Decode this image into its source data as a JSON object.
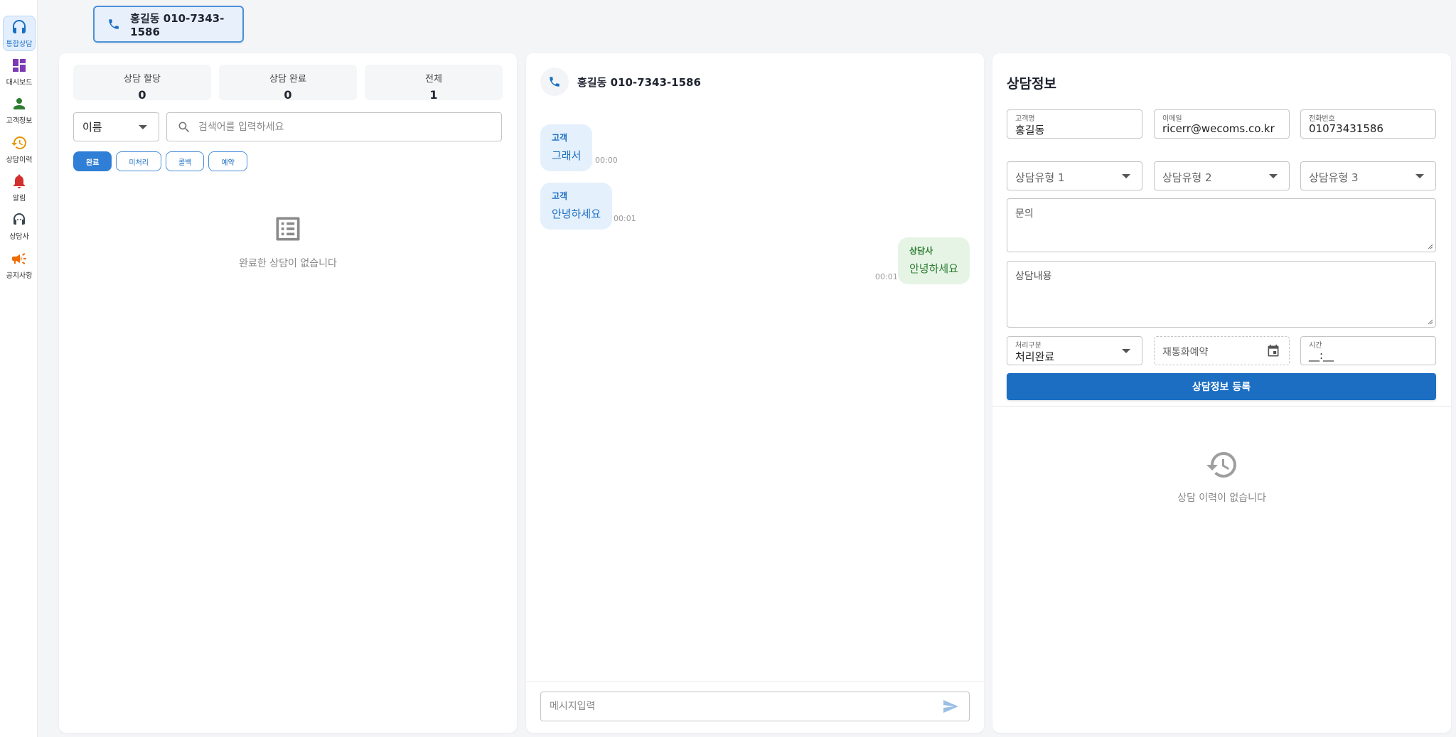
{
  "sidebar": {
    "items": [
      {
        "label": "통합상담",
        "icon": "headset-icon"
      },
      {
        "label": "대시보드",
        "icon": "dashboard-icon"
      },
      {
        "label": "고객정보",
        "icon": "person-icon"
      },
      {
        "label": "상담이력",
        "icon": "history-icon"
      },
      {
        "label": "알림",
        "icon": "bell-icon"
      },
      {
        "label": "상담사",
        "icon": "support-agent-icon"
      },
      {
        "label": "공지사항",
        "icon": "megaphone-icon"
      }
    ],
    "active_color": "#1b6ec2"
  },
  "topbar": {
    "call_tab_label": "홍길동 010-7343-1586"
  },
  "left": {
    "stats": [
      {
        "title": "상담 할당",
        "value": "0"
      },
      {
        "title": "상담 완료",
        "value": "0"
      },
      {
        "title": "전체",
        "value": "1"
      }
    ],
    "search_field": "이름",
    "search_placeholder": "검색어를 입력하세요",
    "filters": [
      "완료",
      "미처리",
      "콜백",
      "예약"
    ],
    "active_filter": "완료",
    "empty_text": "완료한 상담이 없습니다"
  },
  "chat": {
    "title": "홍길동 010-7343-1586",
    "messages": [
      {
        "sender": "고객",
        "text": "그래서",
        "time": "00:00",
        "direction": "in"
      },
      {
        "sender": "고객",
        "text": "안녕하세요",
        "time": "00:01",
        "direction": "in"
      },
      {
        "sender": "상담사",
        "text": "안녕하세요",
        "time": "00:01",
        "direction": "out"
      }
    ],
    "input_placeholder": "메시지입력"
  },
  "info": {
    "title": "상담정보",
    "customer_name": {
      "label": "고객명",
      "value": "홍길동"
    },
    "email": {
      "label": "이메일",
      "value": "ricerr@wecoms.co.kr"
    },
    "phone": {
      "label": "전화번호",
      "value": "01073431586"
    },
    "type1": "상담유형 1",
    "type2": "상담유형 2",
    "type3": "상담유형 3",
    "inquiry_placeholder": "문의",
    "content_placeholder": "상담내용",
    "process": {
      "label": "처리구분",
      "value": "처리완료"
    },
    "recall_placeholder": "재통화예약",
    "time": {
      "label": "시간",
      "value": "__:__"
    },
    "submit_label": "상담정보 등록",
    "empty_history": "상담 이력이 없습니다",
    "accent_color": "#1b6ec2"
  }
}
